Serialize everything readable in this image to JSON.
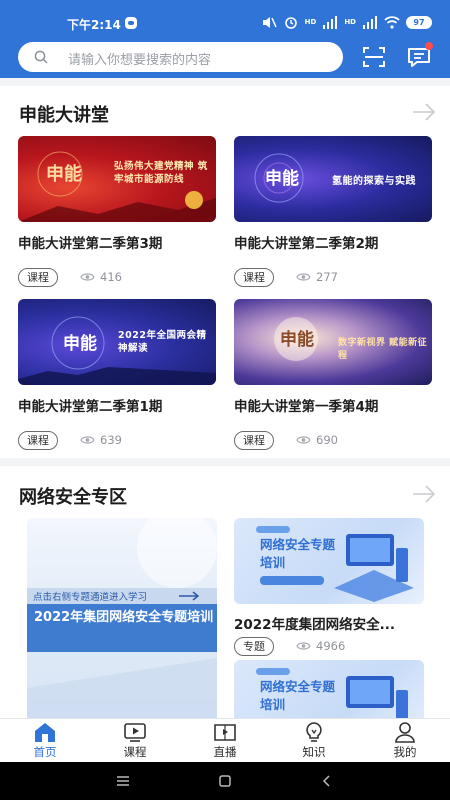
{
  "status_bar": {
    "time": "下午2:14",
    "hd1": "HD",
    "hd2": "HD",
    "battery": "97"
  },
  "search": {
    "placeholder": "请输入你想要搜索的内容"
  },
  "lecture_section": {
    "title": "申能大讲堂",
    "cards": [
      {
        "title": "申能大讲堂第二季第3期",
        "tag": "课程",
        "views": "416",
        "thumb_text": "弘扬伟大建党精神 筑牢城市能源防线"
      },
      {
        "title": "申能大讲堂第二季第2期",
        "tag": "课程",
        "views": "277",
        "thumb_text": "氢能的探索与实践"
      },
      {
        "title": "申能大讲堂第二季第1期",
        "tag": "课程",
        "views": "639",
        "thumb_text": "2022年全国两会精神解读"
      },
      {
        "title": "申能大讲堂第一季第4期",
        "tag": "课程",
        "views": "690",
        "thumb_text": "数字新视界 赋能新征程"
      }
    ]
  },
  "security_section": {
    "title": "网络安全专区",
    "promo": {
      "hint": "点击右侧专题通道进入学习",
      "title": "2022年集团网络安全专题培训"
    },
    "cards": [
      {
        "title": "2022年度集团网络安全...",
        "tag": "专题",
        "views": "4966",
        "thumb_text": "网络安全专题培训"
      },
      {
        "thumb_text": "网络安全专题培训"
      }
    ]
  },
  "nav": {
    "items": [
      {
        "label": "首页",
        "icon": "home-icon",
        "active": true
      },
      {
        "label": "课程",
        "icon": "play-icon"
      },
      {
        "label": "直播",
        "icon": "live-icon"
      },
      {
        "label": "知识",
        "icon": "bulb-icon"
      },
      {
        "label": "我的",
        "icon": "user-icon"
      }
    ]
  },
  "colors": {
    "brand": "#2f74d6",
    "badge": "#ff4c4c"
  }
}
